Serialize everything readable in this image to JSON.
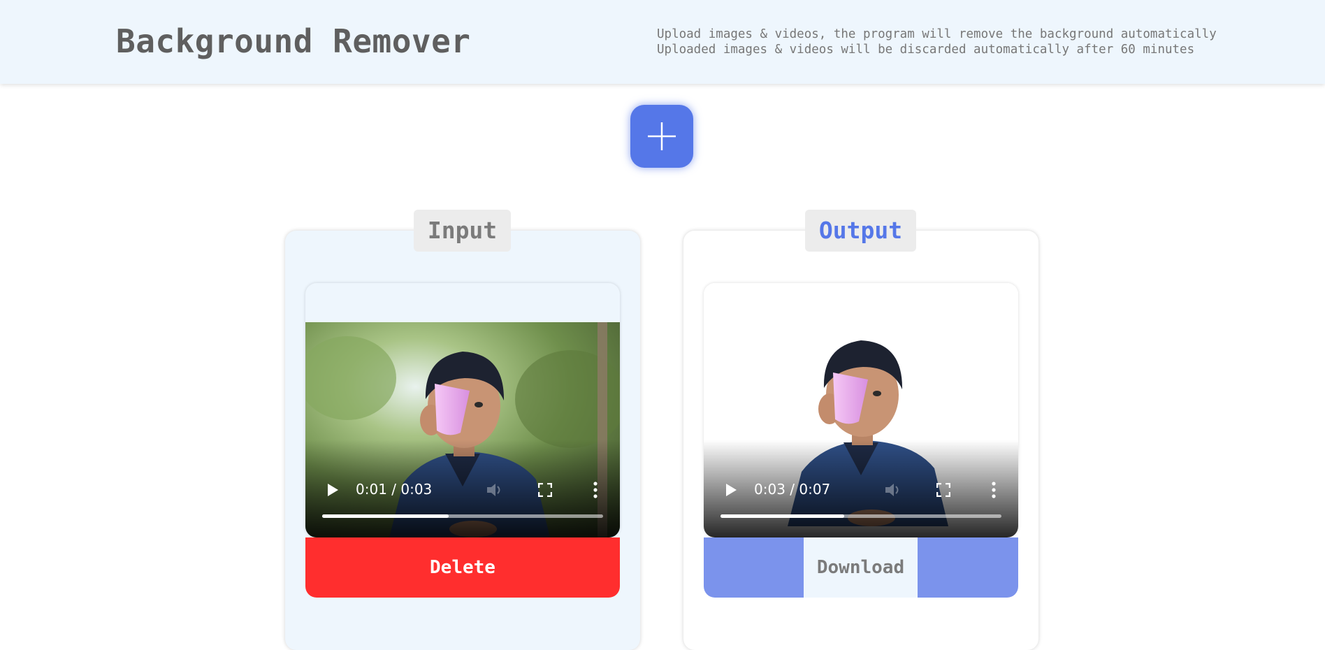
{
  "header": {
    "title": "Background Remover",
    "info_line_1": "Upload images & videos, the program will remove the background automatically",
    "info_line_2": "Uploaded images & videos will be discarded automatically after 60 minutes"
  },
  "upload": {
    "icon": "plus-icon"
  },
  "input_panel": {
    "label": "Input",
    "video": {
      "time": "0:01 / 0:03",
      "progress": 0.45
    },
    "delete_label": "Delete"
  },
  "output_panel": {
    "label": "Output",
    "video": {
      "time": "0:03 / 0:07",
      "progress": 0.44
    },
    "download_label": "Download"
  },
  "colors": {
    "accent": "#5577e8",
    "delete": "#ff2e2e",
    "download_bar": "#7b93ec",
    "header_bg": "#eef6fd"
  }
}
